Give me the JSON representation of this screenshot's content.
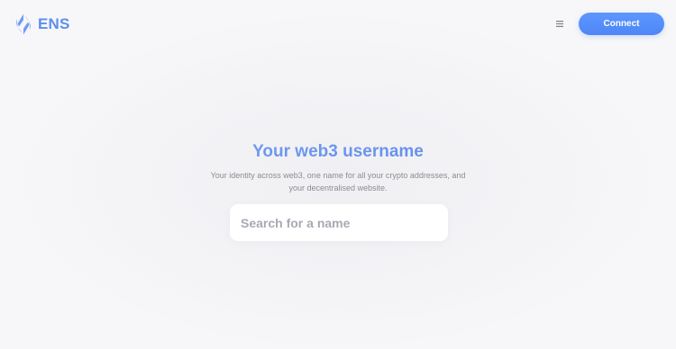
{
  "brand": {
    "name": "ENS",
    "color": "#5b8ef0",
    "icon": "ens-logo-icon"
  },
  "header": {
    "menu_icon": "hamburger-menu-icon",
    "connect_label": "Connect",
    "connect_color": "#5290f8"
  },
  "hero": {
    "title": "Your web3 username",
    "subtitle": "Your identity across web3, one name for all your crypto addresses, and your decentralised website.",
    "title_color": "#6c97ee"
  },
  "search": {
    "placeholder": "Search for a name",
    "value": ""
  }
}
